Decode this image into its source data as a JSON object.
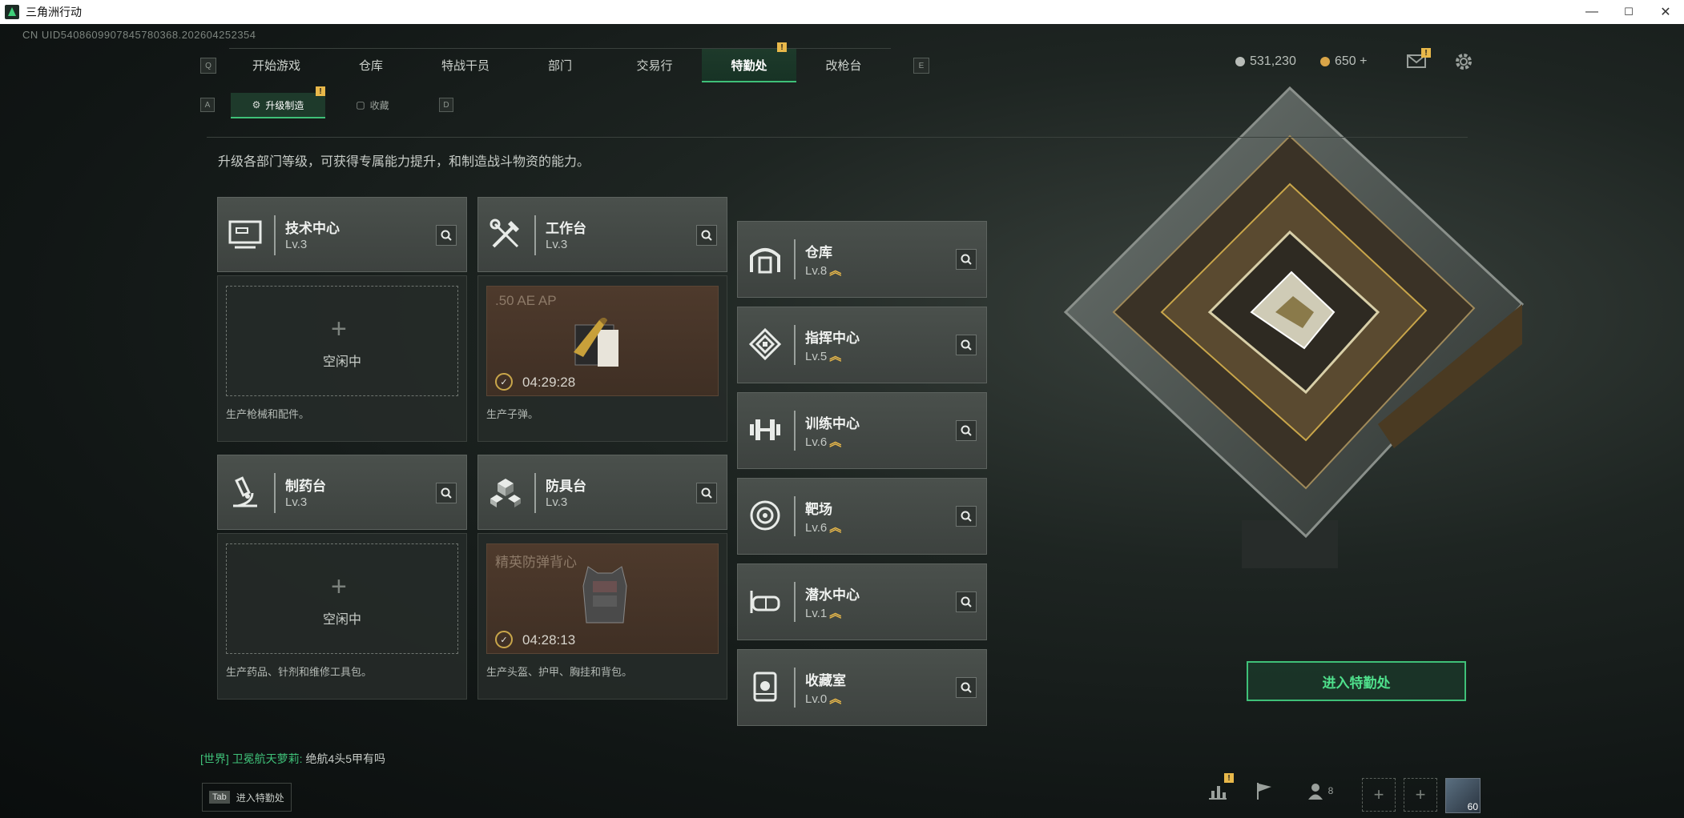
{
  "window": {
    "title": "三角洲行动",
    "minimize": "—",
    "maximize": "☐",
    "close": "✕"
  },
  "uid": "CN UID5408609907845780368.202604252354",
  "top_nav": {
    "left_key": "Q",
    "right_key": "E",
    "tabs": [
      {
        "label": "开始游戏"
      },
      {
        "label": "仓库"
      },
      {
        "label": "特战干员"
      },
      {
        "label": "部门"
      },
      {
        "label": "交易行"
      },
      {
        "label": "特勤处",
        "active": true,
        "badge": "!"
      },
      {
        "label": "改枪台"
      }
    ]
  },
  "currency": {
    "coins": "531,230",
    "gems": "650 +"
  },
  "header_badge": "!",
  "sub_nav": {
    "left_key": "A",
    "right_key": "D",
    "tabs": [
      {
        "label": "升级制造",
        "active": true,
        "badge": "!"
      },
      {
        "label": "收藏"
      }
    ]
  },
  "description": "升级各部门等级，可获得专属能力提升，和制造战斗物资的能力。",
  "departments": [
    {
      "name": "技术中心",
      "level": "Lv.3",
      "upgrade": false,
      "icon": "computer-icon",
      "slot": {
        "state": "idle",
        "plus": "+",
        "text": "空闲中"
      },
      "footer": "生产枪械和配件。"
    },
    {
      "name": "工作台",
      "level": "Lv.3",
      "upgrade": false,
      "icon": "tools-icon",
      "slot": {
        "state": "producing",
        "item": ".50 AE AP",
        "timer": "04:29:28"
      },
      "footer": "生产子弹。"
    },
    {
      "name": "制药台",
      "level": "Lv.3",
      "upgrade": false,
      "icon": "microscope-icon",
      "slot": {
        "state": "idle",
        "plus": "+",
        "text": "空闲中"
      },
      "footer": "生产药品、针剂和维修工具包。"
    },
    {
      "name": "防具台",
      "level": "Lv.3",
      "upgrade": false,
      "icon": "cubes-icon",
      "slot": {
        "state": "producing",
        "item": "精英防弹背心",
        "timer": "04:28:13"
      },
      "footer": "生产头盔、护甲、胸挂和背包。"
    }
  ],
  "side_departments": [
    {
      "name": "仓库",
      "level": "Lv.8",
      "up": "︽",
      "icon": "warehouse-icon"
    },
    {
      "name": "指挥中心",
      "level": "Lv.5",
      "up": "︽",
      "icon": "chip-icon"
    },
    {
      "name": "训练中心",
      "level": "Lv.6",
      "up": "︽",
      "icon": "dumbbell-icon"
    },
    {
      "name": "靶场",
      "level": "Lv.6",
      "up": "︽",
      "icon": "target-icon"
    },
    {
      "name": "潜水中心",
      "level": "Lv.1",
      "up": "︽",
      "icon": "goggles-icon"
    },
    {
      "name": "收藏室",
      "level": "Lv.0",
      "up": "︽",
      "icon": "display-case-icon"
    }
  ],
  "enter_button": "进入特勤处",
  "chat": {
    "channel": "[世界]",
    "user": "卫冕航天萝莉:",
    "message": "绝航4头5甲有吗"
  },
  "tab_hint": {
    "key": "Tab",
    "label": "进入特勤处"
  },
  "bottom_bar": {
    "stats_badge": "!",
    "friends_count": "8",
    "avatar_level": "60"
  },
  "colors": {
    "accent": "#3fc078",
    "badge": "#e8b84a"
  }
}
